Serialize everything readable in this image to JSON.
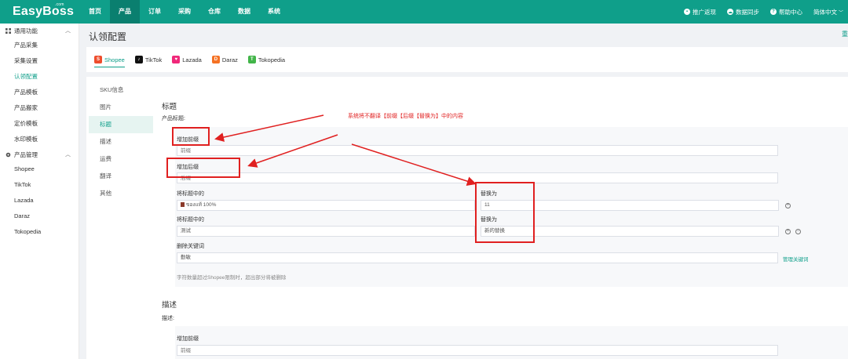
{
  "header": {
    "logo": "EasyBoss",
    "logo_suffix": ".com",
    "nav": [
      {
        "label": "首页"
      },
      {
        "label": "产品"
      },
      {
        "label": "订单"
      },
      {
        "label": "采购"
      },
      {
        "label": "仓库"
      },
      {
        "label": "数据"
      },
      {
        "label": "系统"
      }
    ],
    "right": {
      "promo": "推广返现",
      "sync": "数据同步",
      "help": "帮助中心",
      "language": "简体中文"
    }
  },
  "sidebar": {
    "group1": "通用功能",
    "items1": [
      "产品采集",
      "采集设置",
      "认领配置",
      "产品模板",
      "产品搬家",
      "定价模板",
      "水印模板"
    ],
    "group2": "产品管理",
    "items2": [
      "Shopee",
      "TikTok",
      "Lazada",
      "Daraz",
      "Tokopedia"
    ]
  },
  "page": {
    "title": "认领配置",
    "edge": "重"
  },
  "platforms": [
    "Shopee",
    "TikTok",
    "Lazada",
    "Daraz",
    "Tokopedia"
  ],
  "subnav": [
    "SKU信息",
    "图片",
    "标题",
    "描述",
    "运费",
    "翻译",
    "其他"
  ],
  "title_section": {
    "heading": "标题",
    "product_title_label": "产品标题:",
    "prefix_label": "增加前缀",
    "prefix_placeholder": "前缀",
    "suffix_label": "增加后缀",
    "suffix_placeholder": "后缀",
    "replace_from_label": "将标题中的",
    "replace_to_label": "替换为",
    "row1_from": "ของแท้ 100%",
    "row1_to": "11",
    "row2_from": "测试",
    "row2_to": "新的替换",
    "delete_kw_label": "删除关键词",
    "delete_kw_value": "勤敏",
    "manage_kw_link": "管理关键词",
    "hint": "字符数量超过Shopee限制时，超出部分将被删除"
  },
  "desc_section": {
    "heading": "描述",
    "desc_label": "描述:",
    "prefix_label": "增加前缀",
    "prefix_placeholder": "前缀"
  },
  "annotation": {
    "text": "系统将不翻译【前缀【后缀【替换为】中的内容"
  },
  "colors": {
    "brand": "#0f9f8a",
    "annotation": "#e02020"
  },
  "icons": [
    "gift-icon",
    "cloud-icon",
    "help-icon",
    "chevron-down-icon",
    "grid-icon",
    "gear-icon",
    "chevron-up-icon",
    "plus-circle-icon",
    "minus-circle-icon"
  ]
}
